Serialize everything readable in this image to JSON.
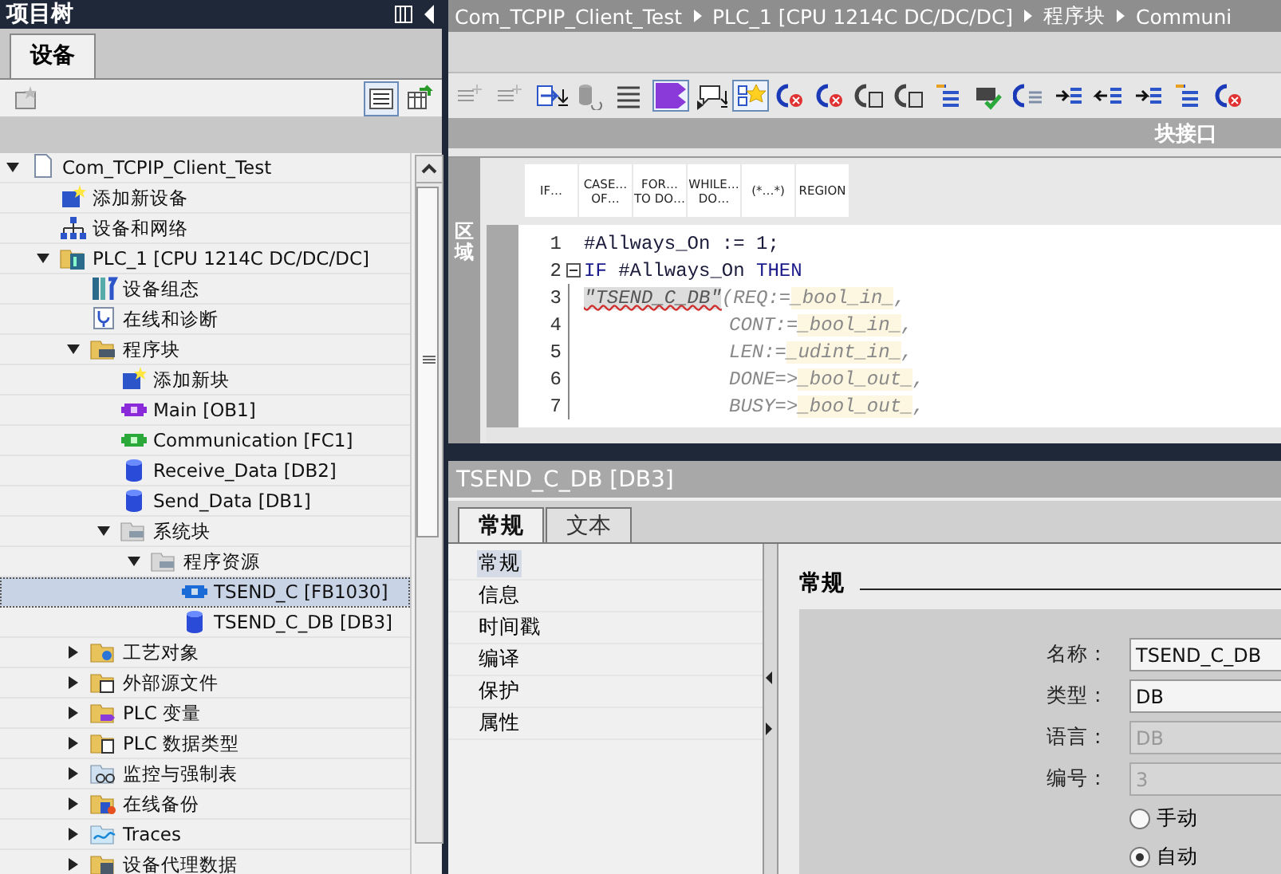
{
  "project_tree": {
    "title": "项目树",
    "tabs": [
      {
        "label": "设备",
        "selected": true
      }
    ],
    "toolbar": [
      {
        "kind": "add-device",
        "on": false
      },
      {
        "kind": "list-view",
        "on": true
      },
      {
        "kind": "table-refresh",
        "on": false
      }
    ],
    "items": [
      {
        "label": "Com_TCPIP_Client_Test",
        "kind": "document",
        "selected": false,
        "expanded": true,
        "children": [
          {
            "label": "添加新设备",
            "kind": "add",
            "selected": false
          },
          {
            "label": "设备和网络",
            "kind": "network",
            "selected": false
          },
          {
            "label": "PLC_1 [CPU 1214C DC/DC/DC]",
            "kind": "plc",
            "selected": false,
            "expanded": true,
            "children": [
              {
                "label": "设备组态",
                "kind": "config",
                "selected": false
              },
              {
                "label": "在线和诊断",
                "kind": "diagnostics",
                "selected": false
              },
              {
                "label": "程序块",
                "kind": "folder-blocks",
                "selected": false,
                "expanded": true,
                "children": [
                  {
                    "label": "添加新块",
                    "kind": "add",
                    "selected": false
                  },
                  {
                    "label": "Main [OB1]",
                    "kind": "block-ob",
                    "selected": false
                  },
                  {
                    "label": "Communication [FC1]",
                    "kind": "block-fc",
                    "selected": false
                  },
                  {
                    "label": "Receive_Data [DB2]",
                    "kind": "db",
                    "selected": false
                  },
                  {
                    "label": "Send_Data [DB1]",
                    "kind": "db",
                    "selected": false
                  },
                  {
                    "label": "系统块",
                    "kind": "folder-system",
                    "selected": false,
                    "expanded": true,
                    "children": [
                      {
                        "label": "程序资源",
                        "kind": "folder-system",
                        "selected": false,
                        "expanded": true,
                        "children": [
                          {
                            "label": "TSEND_C [FB1030]",
                            "kind": "block-fb",
                            "selected": true
                          },
                          {
                            "label": "TSEND_C_DB [DB3]",
                            "kind": "db",
                            "selected": false
                          }
                        ]
                      }
                    ]
                  }
                ]
              },
              {
                "label": "工艺对象",
                "kind": "folder-tech",
                "selected": false,
                "expanded": false
              },
              {
                "label": "外部源文件",
                "kind": "folder-source",
                "selected": false,
                "expanded": false
              },
              {
                "label": "PLC 变量",
                "kind": "folder-tags",
                "selected": false,
                "expanded": false
              },
              {
                "label": "PLC 数据类型",
                "kind": "folder-types",
                "selected": false,
                "expanded": false
              },
              {
                "label": "监控与强制表",
                "kind": "folder-watch",
                "selected": false,
                "expanded": false
              },
              {
                "label": "在线备份",
                "kind": "folder-backup",
                "selected": false,
                "expanded": false
              },
              {
                "label": "Traces",
                "kind": "folder-trace",
                "selected": false,
                "expanded": false
              },
              {
                "label": "设备代理数据",
                "kind": "folder-proxy",
                "selected": false,
                "expanded": false
              }
            ]
          }
        ]
      }
    ]
  },
  "editor": {
    "breadcrumb": [
      "Com_TCPIP_Client_Test",
      "PLC_1 [CPU 1214C DC/DC/DC]",
      "程序块",
      "Communi"
    ],
    "toolbar": [
      {
        "kind": "sparkle",
        "on": false
      },
      {
        "kind": "sparkle",
        "on": false
      },
      {
        "kind": "export",
        "on": false
      },
      {
        "kind": "db-undo",
        "on": false
      },
      {
        "kind": "lines",
        "on": false
      },
      {
        "kind": "tag",
        "on": true
      },
      {
        "kind": "comment",
        "on": false
      },
      {
        "kind": "star",
        "on": true
      },
      {
        "kind": "call-delete",
        "on": false
      },
      {
        "kind": "call-delete",
        "on": false
      },
      {
        "kind": "block-call",
        "on": false
      },
      {
        "kind": "block-call",
        "on": false
      },
      {
        "kind": "list-color",
        "on": false
      },
      {
        "kind": "check",
        "on": false
      },
      {
        "kind": "call-list",
        "on": false
      },
      {
        "kind": "indent",
        "on": false
      },
      {
        "kind": "outdent",
        "on": false
      },
      {
        "kind": "indent",
        "on": false
      },
      {
        "kind": "list-color",
        "on": false
      },
      {
        "kind": "call-delete",
        "on": false
      }
    ],
    "interface_label": "块接口",
    "side_label": "区域",
    "instructions": [
      {
        "label": "IF…"
      },
      {
        "label": "CASE…\nOF…"
      },
      {
        "label": "FOR…\nTO DO…"
      },
      {
        "label": "WHILE…\nDO…"
      },
      {
        "label": "(*…*)"
      },
      {
        "label": "REGION"
      }
    ],
    "code_lines": [
      {
        "number": "1",
        "continuation": false,
        "fold": false,
        "segments": [
          {
            "kind": "plain",
            "text": "#Allways_On := 1;"
          }
        ]
      },
      {
        "number": "2",
        "continuation": false,
        "fold": true,
        "segments": [
          {
            "kind": "keyword",
            "text": "IF"
          },
          {
            "kind": "plain",
            "text": " #Allways_On "
          },
          {
            "kind": "keyword",
            "text": "THEN"
          }
        ]
      },
      {
        "number": "3",
        "continuation": false,
        "fold": false,
        "segments": [
          {
            "kind": "error",
            "text": "\"TSEND_C_DB\""
          },
          {
            "kind": "param",
            "text": "(REQ:="
          },
          {
            "kind": "placeholder",
            "text": "_bool_in_"
          },
          {
            "kind": "param",
            "text": ","
          }
        ]
      },
      {
        "number": "4",
        "continuation": true,
        "fold": false,
        "segments": [
          {
            "kind": "param",
            "text": "CONT:="
          },
          {
            "kind": "placeholder",
            "text": "_bool_in_"
          },
          {
            "kind": "param",
            "text": ","
          }
        ]
      },
      {
        "number": "5",
        "continuation": true,
        "fold": false,
        "segments": [
          {
            "kind": "param",
            "text": "LEN:="
          },
          {
            "kind": "placeholder",
            "text": "_udint_in_"
          },
          {
            "kind": "param",
            "text": ","
          }
        ]
      },
      {
        "number": "6",
        "continuation": true,
        "fold": false,
        "segments": [
          {
            "kind": "param",
            "text": "DONE=>"
          },
          {
            "kind": "placeholder",
            "text": "_bool_out_"
          },
          {
            "kind": "param",
            "text": ","
          }
        ]
      },
      {
        "number": "7",
        "continuation": true,
        "fold": false,
        "segments": [
          {
            "kind": "param",
            "text": "BUSY=>"
          },
          {
            "kind": "placeholder",
            "text": "_bool_out_"
          },
          {
            "kind": "param",
            "text": ","
          }
        ]
      }
    ]
  },
  "properties": {
    "title": "TSEND_C_DB [DB3]",
    "tabs": [
      {
        "label": "常规",
        "selected": true
      },
      {
        "label": "文本",
        "selected": false
      }
    ],
    "nav": [
      {
        "label": "常规",
        "selected": true
      },
      {
        "label": "信息",
        "selected": false
      },
      {
        "label": "时间戳",
        "selected": false
      },
      {
        "label": "编译",
        "selected": false
      },
      {
        "label": "保护",
        "selected": false
      },
      {
        "label": "属性",
        "selected": false
      }
    ],
    "section_title": "常规",
    "fields": [
      {
        "label": "名称 :",
        "value": "TSEND_C_DB",
        "disabled": false
      },
      {
        "label": "类型 :",
        "value": "DB",
        "disabled": false
      },
      {
        "label": "语言 :",
        "value": "DB",
        "disabled": true
      },
      {
        "label": "编号 :",
        "value": "3",
        "disabled": true
      }
    ],
    "radios": [
      {
        "label": "手动",
        "selected": false
      },
      {
        "label": "自动",
        "selected": true
      }
    ]
  }
}
